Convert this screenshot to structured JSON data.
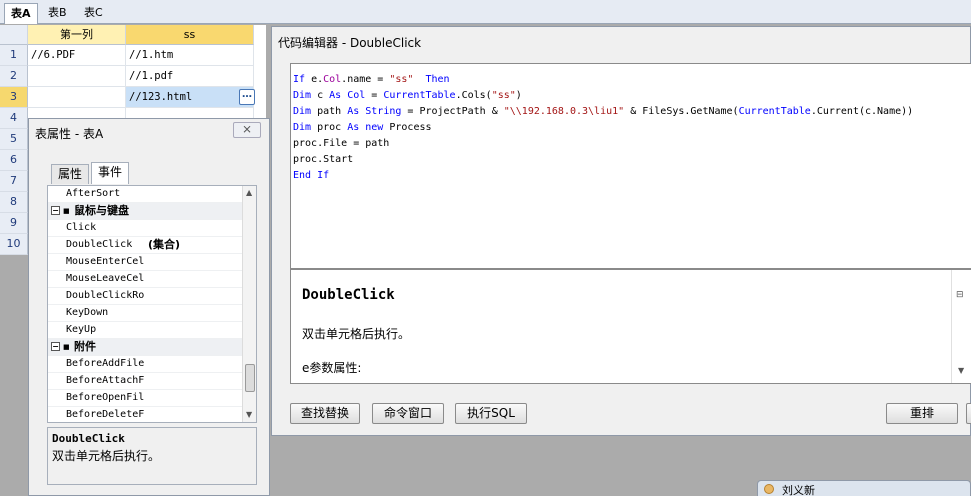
{
  "tabs": [
    "表A",
    "表B",
    "表C"
  ],
  "grid": {
    "columns": [
      "第一列",
      "ss"
    ],
    "row_numbers": [
      "1",
      "2",
      "3",
      "4",
      "5",
      "6",
      "7",
      "8",
      "9",
      "10"
    ],
    "rows": [
      [
        "//6.PDF",
        "//1.htm"
      ],
      [
        "",
        "//1.pdf"
      ],
      [
        "",
        "//123.html"
      ]
    ],
    "ellipsis": "…"
  },
  "properties": {
    "title": "表属性 - 表A",
    "close_glyph": "⨯",
    "tabs": [
      "属性",
      "事件"
    ],
    "items": [
      {
        "name": "AfterSort"
      },
      {
        "name": "鼠标与键盘",
        "category": true,
        "expander": "⊟",
        "icon": "■"
      },
      {
        "name": "Click"
      },
      {
        "name": "DoubleClick",
        "value": "(集合)"
      },
      {
        "name": "MouseEnterCel"
      },
      {
        "name": "MouseLeaveCel"
      },
      {
        "name": "DoubleClickRo"
      },
      {
        "name": "KeyDown"
      },
      {
        "name": "KeyUp"
      },
      {
        "name": "附件",
        "category": true,
        "expander": "⊟",
        "icon": "■"
      },
      {
        "name": "BeforeAddFile"
      },
      {
        "name": "BeforeAttachF"
      },
      {
        "name": "BeforeOpenFil"
      },
      {
        "name": "BeforeDeleteF"
      }
    ],
    "scroll_up": "▲",
    "scroll_down": "▼",
    "desc_title": "DoubleClick",
    "desc_text": "双击单元格后执行。"
  },
  "editor": {
    "title": "代码编辑器 - DoubleClick",
    "code": [
      [
        {
          "t": "If ",
          "c": "kw"
        },
        {
          "t": "e.",
          "c": "pl"
        },
        {
          "t": "Col",
          "c": "mg"
        },
        {
          "t": ".name = ",
          "c": "pl"
        },
        {
          "t": "\"ss\"",
          "c": "str"
        },
        {
          "t": "  Then",
          "c": "kw"
        }
      ],
      [
        {
          "t": "Dim ",
          "c": "kw"
        },
        {
          "t": "c ",
          "c": "pl"
        },
        {
          "t": "As ",
          "c": "kw"
        },
        {
          "t": "Col",
          "c": "ty"
        },
        {
          "t": " = ",
          "c": "pl"
        },
        {
          "t": "CurrentTable",
          "c": "ty"
        },
        {
          "t": ".Cols(",
          "c": "pl"
        },
        {
          "t": "\"ss\"",
          "c": "str"
        },
        {
          "t": ")",
          "c": "pl"
        }
      ],
      [
        {
          "t": "Dim ",
          "c": "kw"
        },
        {
          "t": "path ",
          "c": "pl"
        },
        {
          "t": "As ",
          "c": "kw"
        },
        {
          "t": "String",
          "c": "ty"
        },
        {
          "t": " = ProjectPath & ",
          "c": "pl"
        },
        {
          "t": "\"\\\\192.168.0.3\\liu1\"",
          "c": "str"
        },
        {
          "t": " & FileSys.GetName(",
          "c": "pl"
        },
        {
          "t": "CurrentTable",
          "c": "ty"
        },
        {
          "t": ".Current(c.Name))",
          "c": "pl"
        }
      ],
      [
        {
          "t": "Dim ",
          "c": "kw"
        },
        {
          "t": "proc ",
          "c": "pl"
        },
        {
          "t": "As new ",
          "c": "kw"
        },
        {
          "t": "Process",
          "c": "pl"
        }
      ],
      [
        {
          "t": "proc.File = path",
          "c": "pl"
        }
      ],
      [
        {
          "t": "proc.Start",
          "c": "pl"
        }
      ],
      [
        {
          "t": "End If",
          "c": "kw"
        }
      ]
    ],
    "help_title": "DoubleClick",
    "help_line1": "双击单元格后执行。",
    "help_line2": "e参数属性:",
    "help_scroll_mark": "⊟",
    "help_scroll_down": "▼",
    "buttons": [
      "查找替换",
      "命令窗口",
      "执行SQL",
      "重排"
    ]
  },
  "peek_window": {
    "title": "刘义新"
  },
  "colors": {
    "header_yellow": "#fff1b3",
    "selected_header": "#f9d86f",
    "selected_cell": "#c9e0f7",
    "keyword_blue": "#0000ff",
    "string_red": "#a31515"
  }
}
